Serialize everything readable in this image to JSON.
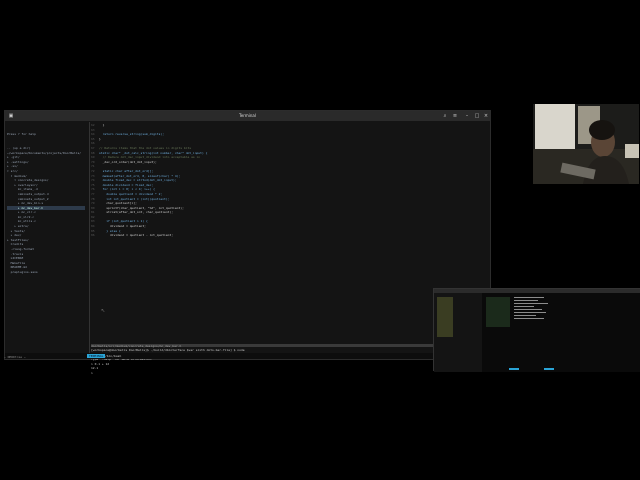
{
  "window": {
    "title": "Terminal"
  },
  "tree": {
    "header": "Press ? for help",
    "items": [
      "",
      ".. (up a dir)",
      "~/workspace/Documents/projects/DoorBells/",
      "▸ .git/",
      "▸ .settings/",
      "▸ .sx/",
      "▾ src/",
      "  ▾ medium/",
      "    ▾ concrete_designs/",
      "    ▸ overlaysnr/",
      "      mc_items_.d",
      "      cabinets_output.d",
      "      cabinets_output_2",
      "      ▸ mc_dev_bin.s",
      "      ▸ mc_dev_bar.h",
      "      ▸ mc_vlr.c",
      "      mc_vlr2.c",
      "      mc_utils.c",
      "    ▸ extra/",
      "  ▸ tests/",
      "  ▸ dev/",
      "▸ testFiles/",
      "  Credits",
      "  .clang-format",
      "  .travis",
      "  LICENSE",
      "  Makefile",
      "  README.md",
      "  preplugins.sans"
    ],
    "selected_index": 14
  },
  "editor": {
    "lines": [
      {
        "n": "62",
        "t": "  }"
      },
      {
        "n": "63",
        "t": ""
      },
      {
        "n": "64",
        "t": "  return reverse_string(sum_digits);"
      },
      {
        "n": "65",
        "t": "}"
      },
      {
        "n": "66",
        "t": ""
      },
      {
        "n": "67",
        "t": "// Returns items that the dot values in digits bits"
      },
      {
        "n": "68",
        "t": "static char* _dot_calc_string(int number, char* dot_input) {"
      },
      {
        "n": "69",
        "t": "  // Reduce dot_dec_input_dividend into acceptable as in"
      },
      {
        "n": "70",
        "t": "  _dec_ord_order(dot_dot_input);"
      },
      {
        "n": "71",
        "t": ""
      },
      {
        "n": "72",
        "t": "  static char after_dot_ord[];"
      },
      {
        "n": "73",
        "t": "  memset(after_dot_ord, 0, sizeof(char) * 4);"
      },
      {
        "n": "74",
        "t": "  double fixed_dec = strtod(dot_dot_input);"
      },
      {
        "n": "75",
        "t": "  double dividend = fixed_dec;"
      },
      {
        "n": "76",
        "t": "  for (int i = 0; i < 4; i++) {"
      },
      {
        "n": "77",
        "t": "    double quotient = dividend * 2;"
      },
      {
        "n": "78",
        "t": "    int int_quotient = (int)(quotient);"
      },
      {
        "n": "79",
        "t": "    char_quotient[i];"
      },
      {
        "n": "80",
        "t": "    sprintf(char_quotient, \"%d\", int_quotient);"
      },
      {
        "n": "81",
        "t": "    strcat(after_dot_ord, char_quotient);"
      },
      {
        "n": "82",
        "t": ""
      },
      {
        "n": "83",
        "t": "    if (int_quotient > 1) {"
      },
      {
        "n": "84",
        "t": "      dividend = quotient;"
      },
      {
        "n": "85",
        "t": "    } else {"
      },
      {
        "n": "86",
        "t": "      dividend = quotient - int_quotient;"
      }
    ]
  },
  "status_top": "doorbells/src/medium/concrete_designs/mc_dev_bar.h",
  "terminal": {
    "lines": [
      "[workspace@doorbells DoorBells]$ ./build/dbinterface $var sixth dots-bar-file] $ node",
      "Welcome to Node.js v12.18.1.",
      "Type \".help\" for more information.",
      "> 0.1 + 12",
      "12.1",
      ">"
    ]
  },
  "statusbar": {
    "mode": "TERMINAL",
    "path": "/bin/bash"
  },
  "bottom_left": "~ NERDtree ~",
  "colors": {
    "mode_bg": "#2aa4d6",
    "window_bg": "#141414",
    "titlebar_bg": "#2a2a2a"
  }
}
